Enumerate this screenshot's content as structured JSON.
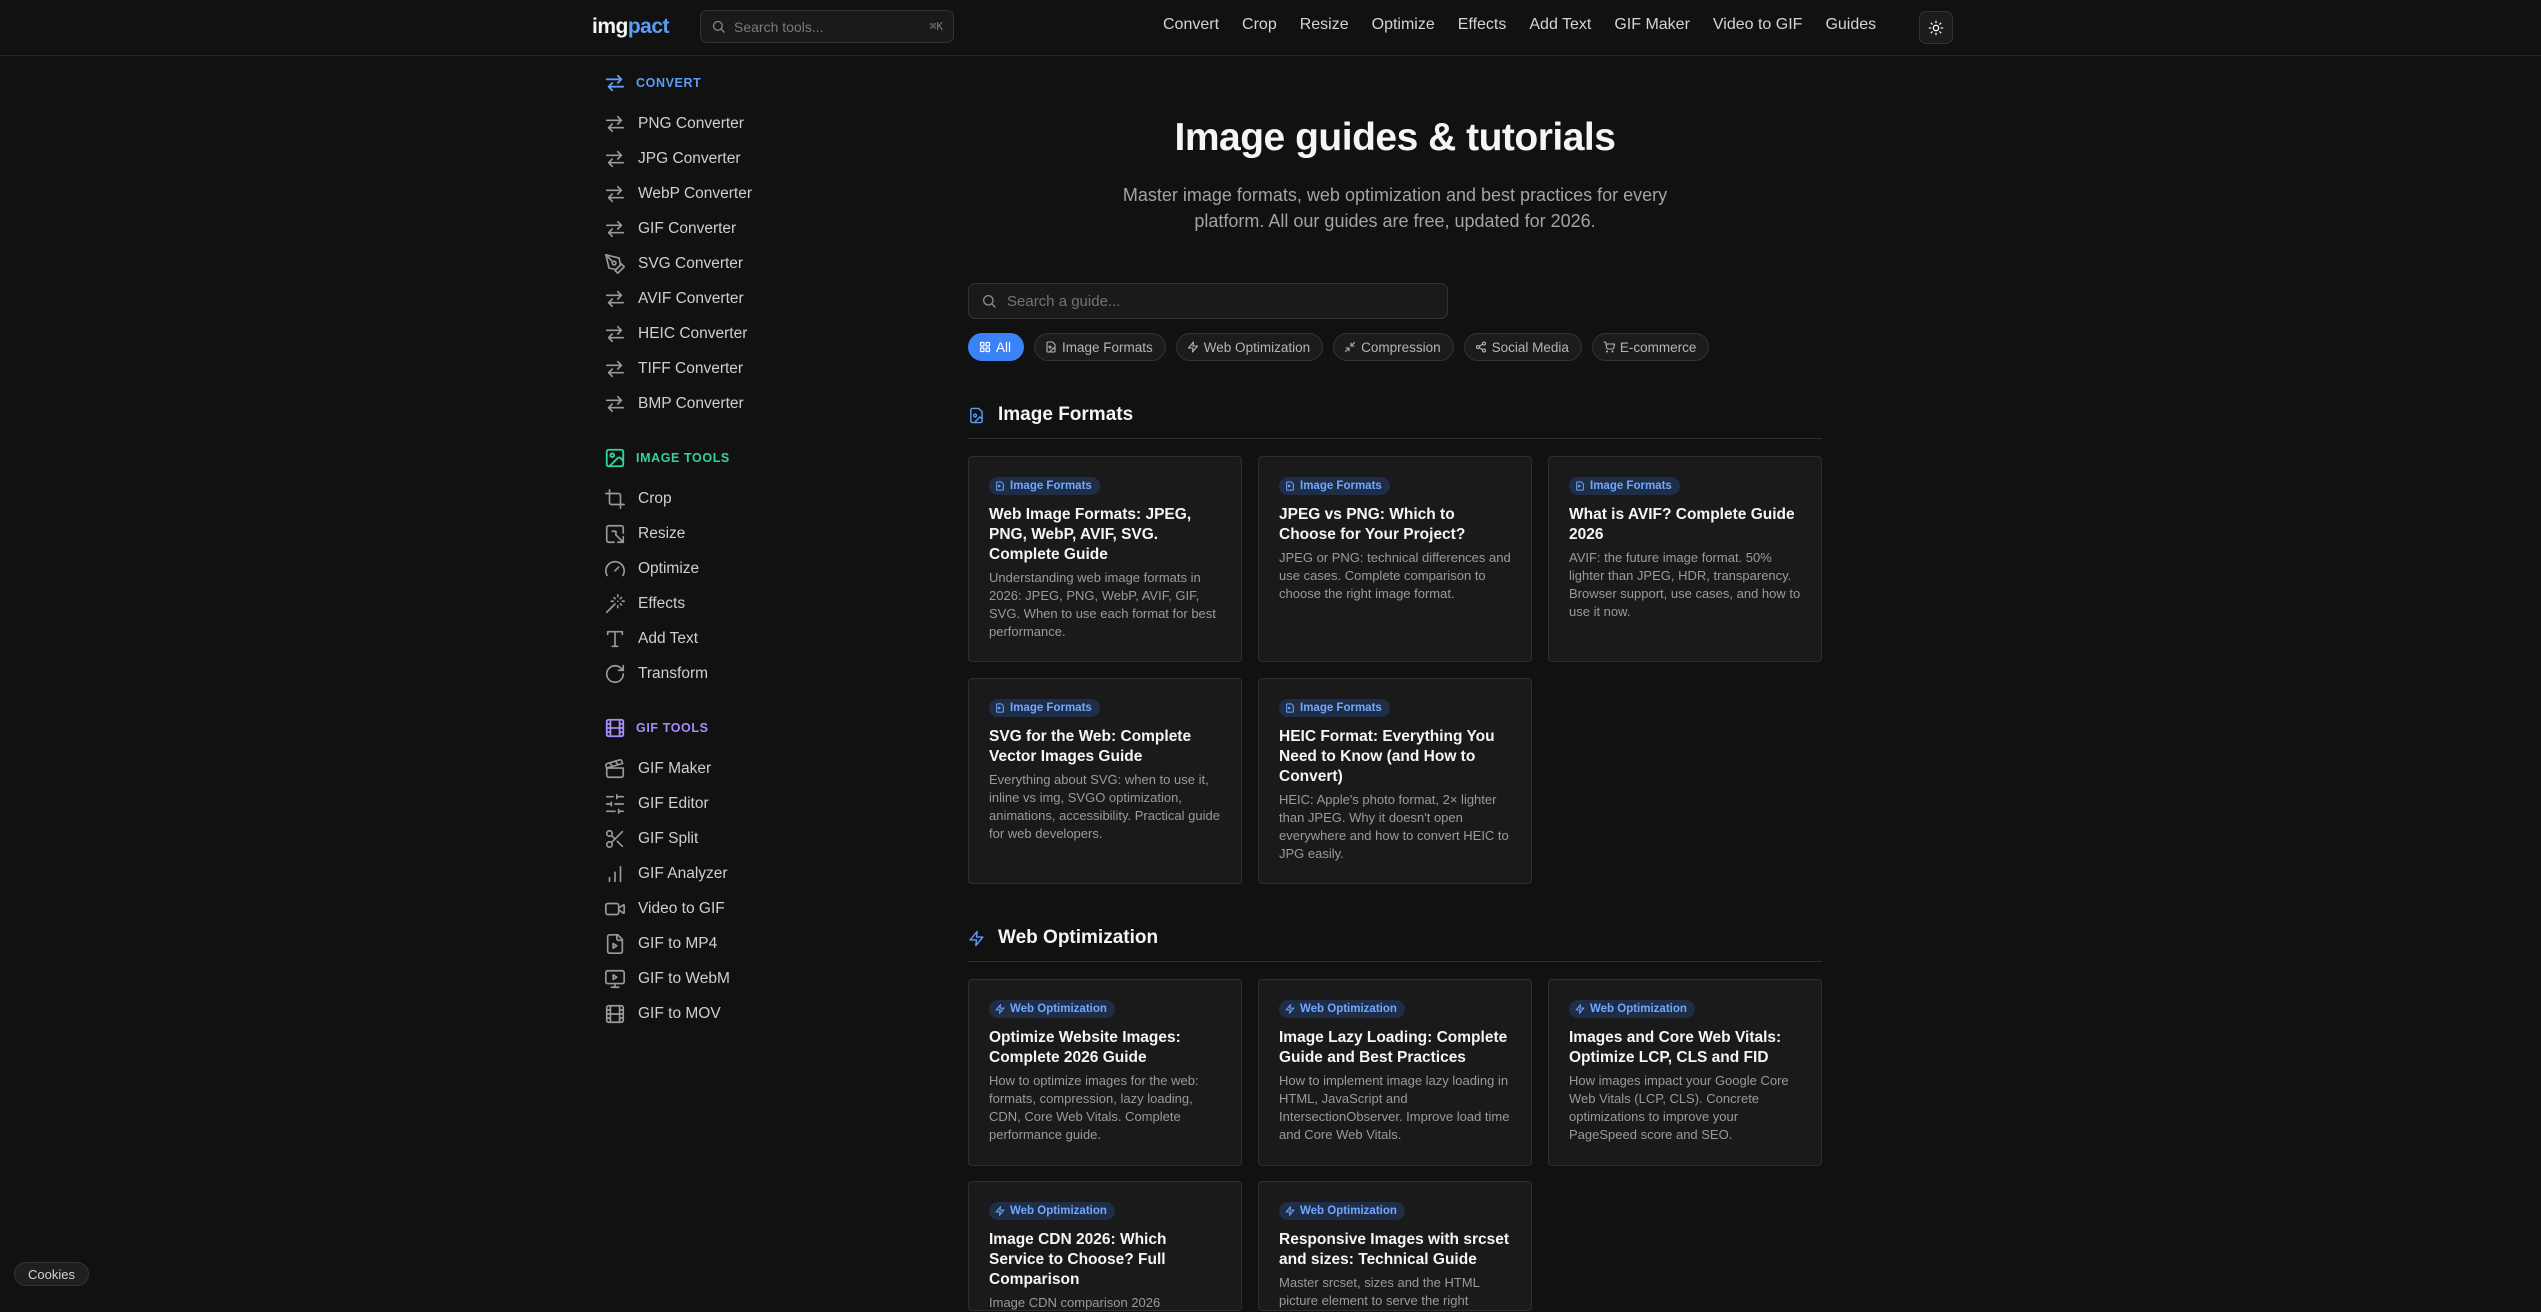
{
  "header": {
    "logo_main": "img",
    "logo_accent": "pact",
    "search_placeholder": "Search tools...",
    "search_shortcut": "⌘K",
    "nav": [
      "Convert",
      "Crop",
      "Resize",
      "Optimize",
      "Effects",
      "Add Text",
      "GIF Maker",
      "Video to GIF",
      "Guides"
    ],
    "theme_icon": "sun-icon"
  },
  "sidebar": {
    "convert": {
      "title": "CONVERT",
      "color": "#5b9cf6",
      "items": [
        {
          "label": "PNG Converter",
          "icon": "arrows-swap-icon"
        },
        {
          "label": "JPG Converter",
          "icon": "arrows-swap-icon"
        },
        {
          "label": "WebP Converter",
          "icon": "arrows-swap-icon"
        },
        {
          "label": "GIF Converter",
          "icon": "arrows-swap-icon"
        },
        {
          "label": "SVG Converter",
          "icon": "pen-tool-icon"
        },
        {
          "label": "AVIF Converter",
          "icon": "arrows-swap-icon"
        },
        {
          "label": "HEIC Converter",
          "icon": "arrows-swap-icon"
        },
        {
          "label": "TIFF Converter",
          "icon": "arrows-swap-icon"
        },
        {
          "label": "BMP Converter",
          "icon": "arrows-swap-icon"
        }
      ]
    },
    "image_tools": {
      "title": "IMAGE TOOLS",
      "color": "#34d399",
      "items": [
        {
          "label": "Crop",
          "icon": "crop-icon"
        },
        {
          "label": "Resize",
          "icon": "resize-icon"
        },
        {
          "label": "Optimize",
          "icon": "gauge-icon"
        },
        {
          "label": "Effects",
          "icon": "magic-wand-icon"
        },
        {
          "label": "Add Text",
          "icon": "text-icon"
        },
        {
          "label": "Transform",
          "icon": "rotate-icon"
        }
      ]
    },
    "gif_tools": {
      "title": "GIF TOOLS",
      "color": "#a78bfa",
      "items": [
        {
          "label": "GIF Maker",
          "icon": "clapperboard-icon"
        },
        {
          "label": "GIF Editor",
          "icon": "sliders-icon"
        },
        {
          "label": "GIF Split",
          "icon": "scissors-icon"
        },
        {
          "label": "GIF Analyzer",
          "icon": "bar-chart-icon"
        },
        {
          "label": "Video to GIF",
          "icon": "video-icon"
        },
        {
          "label": "GIF to MP4",
          "icon": "file-play-icon"
        },
        {
          "label": "GIF to WebM",
          "icon": "monitor-play-icon"
        },
        {
          "label": "GIF to MOV",
          "icon": "film-icon"
        }
      ]
    }
  },
  "hero": {
    "title": "Image guides & tutorials",
    "subtitle": "Master image formats, web optimization and best practices for every platform. All our guides are free, updated for 2026."
  },
  "guide_search_placeholder": "Search a guide...",
  "filters": [
    "All",
    "Image Formats",
    "Web Optimization",
    "Compression",
    "Social Media",
    "E-commerce"
  ],
  "sections": [
    {
      "title": "Image Formats",
      "cards": [
        {
          "badge": "Image Formats",
          "title": "Web Image Formats: JPEG, PNG, WebP, AVIF, SVG. Complete Guide",
          "desc": "Understanding web image formats in 2026: JPEG, PNG, WebP, AVIF, GIF, SVG. When to use each format for best performance."
        },
        {
          "badge": "Image Formats",
          "title": "JPEG vs PNG: Which to Choose for Your Project?",
          "desc": "JPEG or PNG: technical differences and use cases. Complete comparison to choose the right image format."
        },
        {
          "badge": "Image Formats",
          "title": "What is AVIF? Complete Guide 2026",
          "desc": "AVIF: the future image format. 50% lighter than JPEG, HDR, transparency. Browser support, use cases, and how to use it now."
        },
        {
          "badge": "Image Formats",
          "title": "SVG for the Web: Complete Vector Images Guide",
          "desc": "Everything about SVG: when to use it, inline vs img, SVGO optimization, animations, accessibility. Practical guide for web developers."
        },
        {
          "badge": "Image Formats",
          "title": "HEIC Format: Everything You Need to Know (and How to Convert)",
          "desc": "HEIC: Apple's photo format, 2× lighter than JPEG. Why it doesn't open everywhere and how to convert HEIC to JPG easily."
        }
      ]
    },
    {
      "title": "Web Optimization",
      "cards": [
        {
          "badge": "Web Optimization",
          "title": "Optimize Website Images: Complete 2026 Guide",
          "desc": "How to optimize images for the web: formats, compression, lazy loading, CDN, Core Web Vitals. Complete performance guide."
        },
        {
          "badge": "Web Optimization",
          "title": "Image Lazy Loading: Complete Guide and Best Practices",
          "desc": "How to implement image lazy loading in HTML, JavaScript and IntersectionObserver. Improve load time and Core Web Vitals."
        },
        {
          "badge": "Web Optimization",
          "title": "Images and Core Web Vitals: Optimize LCP, CLS and FID",
          "desc": "How images impact your Google Core Web Vitals (LCP, CLS). Concrete optimizations to improve your PageSpeed score and SEO."
        },
        {
          "badge": "Web Optimization",
          "title": "Image CDN 2026: Which Service to Choose? Full Comparison",
          "desc": "Image CDN comparison 2026"
        },
        {
          "badge": "Web Optimization",
          "title": "Responsive Images with srcset and sizes: Technical Guide",
          "desc": "Master srcset, sizes and the HTML picture element to serve the right"
        }
      ]
    }
  ],
  "cookies_label": "Cookies"
}
